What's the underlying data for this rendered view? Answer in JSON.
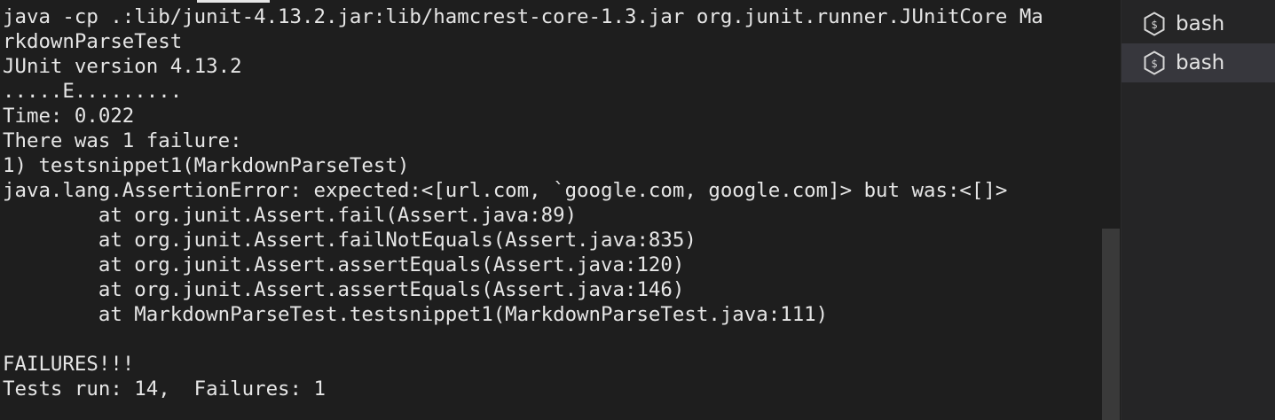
{
  "terminal": {
    "lines": [
      "java -cp .:lib/junit-4.13.2.jar:lib/hamcrest-core-1.3.jar org.junit.runner.JUnitCore Ma",
      "rkdownParseTest",
      "JUnit version 4.13.2",
      ".....E.........",
      "Time: 0.022",
      "There was 1 failure:",
      "1) testsnippet1(MarkdownParseTest)",
      "java.lang.AssertionError: expected:<[url.com, `google.com, google.com]> but was:<[]>",
      "        at org.junit.Assert.fail(Assert.java:89)",
      "        at org.junit.Assert.failNotEquals(Assert.java:835)",
      "        at org.junit.Assert.assertEquals(Assert.java:120)",
      "        at org.junit.Assert.assertEquals(Assert.java:146)",
      "        at MarkdownParseTest.testsnippet1(MarkdownParseTest.java:111)",
      "",
      "FAILURES!!!",
      "Tests run: 14,  Failures: 1"
    ]
  },
  "panel": {
    "tabs": [
      {
        "label": "bash",
        "icon": "terminal-shell-icon",
        "active": false
      },
      {
        "label": "bash",
        "icon": "terminal-shell-icon",
        "active": true
      }
    ]
  }
}
